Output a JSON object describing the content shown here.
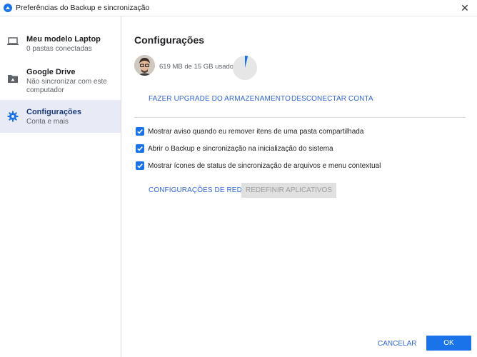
{
  "window": {
    "title": "Preferências do Backup e sincronização",
    "close_glyph": "✕"
  },
  "sidebar": {
    "items": [
      {
        "label": "Meu modelo Laptop",
        "sub": "0 pastas conectadas",
        "icon": "laptop-icon"
      },
      {
        "label": "Google Drive",
        "sub": "Não sincronizar com este",
        "sub2": "computador",
        "icon": "drive-icon"
      },
      {
        "label": "Configurações",
        "sub": "Conta e mais",
        "icon": "gear-icon"
      }
    ]
  },
  "main": {
    "title": "Configurações",
    "storage": {
      "text": "619 MB de 15 GB usados",
      "used_fraction": 0.04
    },
    "upgrade_label": "FAZER UPGRADE DO ARMAZENAMENTO",
    "disconnect_label": "DESCONECTAR CONTA",
    "options": [
      {
        "label": "Mostrar aviso quando eu remover itens de uma pasta compartilhada",
        "checked": true
      },
      {
        "label": "Abrir o Backup e sincronização na inicialização do sistema",
        "checked": true
      },
      {
        "label": "Mostrar ícones de status de sincronização de arquivos e menu contextual",
        "checked": true
      }
    ],
    "network_label": "CONFIGURAÇÕES DE REDE",
    "reset_label": "REDEFINIR APLICATIVOS"
  },
  "footer": {
    "cancel_label": "CANCELAR",
    "ok_label": "OK"
  },
  "colors": {
    "accent": "#1a73e8",
    "link": "#3367d6",
    "active_bg": "#e8eaf6"
  }
}
